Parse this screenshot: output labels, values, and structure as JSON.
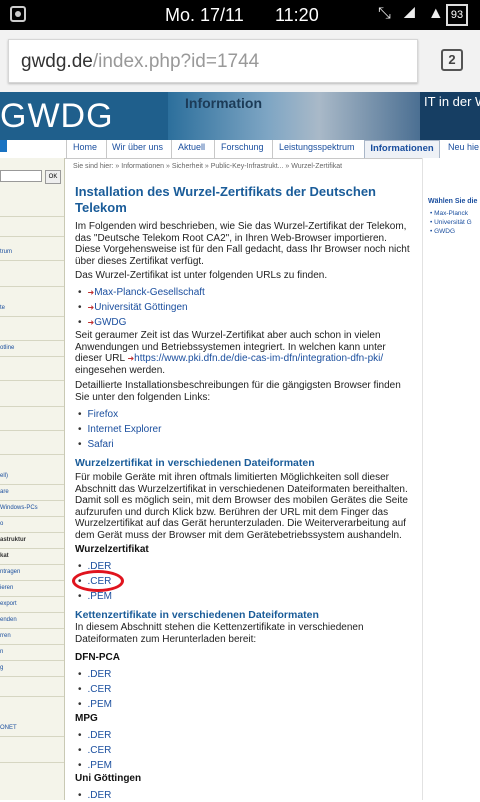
{
  "status": {
    "date": "Mo. 17/11",
    "time": "11:20",
    "battery": "93"
  },
  "browser": {
    "url_host": "gwdg.de",
    "url_path": "/index.php?id=1744",
    "tab_count": "2"
  },
  "banner": {
    "logo": "GWDG",
    "info_label": "Information",
    "tagline": "IT in der W"
  },
  "nav": {
    "items": [
      "Home",
      "Wir über uns",
      "Aktuell",
      "Forschung",
      "Leistungsspektrum"
    ],
    "active": "Informationen",
    "more": "Neu hie"
  },
  "sidebar": {
    "ok": "OK",
    "items": [
      "trum",
      "te",
      "otline",
      "ell)",
      "are",
      "Windows-PCs",
      "o",
      "astruktur",
      "kat",
      "ntragen",
      "ieren",
      "export",
      "enden",
      "rren",
      "n",
      "g",
      "ONET"
    ]
  },
  "breadcrumb": "Sie sind hier: » Informationen » Sicherheit » Public-Key-Infrastrukt... » Wurzel-Zertifikat",
  "right": {
    "title": "Wählen Sie die",
    "links": [
      "Max-Planck",
      "Universität G",
      "GWDG"
    ]
  },
  "main": {
    "title": "Installation des Wurzel-Zertifikats der Deutschen Telekom",
    "intro": "Im Folgenden wird beschrieben, wie Sie das Wurzel-Zertifikat der Telekom, das \"Deutsche Telekom Root CA2\", in Ihren Web-Browser importieren. Diese Vorgehensweise ist für den Fall gedacht, dass Ihr Browser noch nicht über dieses Zertifikat verfügt.",
    "urls_intro": "Das Wurzel-Zertifikat ist unter folgenden URLs zu finden.",
    "url_links": [
      "Max-Planck-Gesellschaft",
      "Universität Göttingen",
      "GWDG"
    ],
    "time_text": "Seit geraumer Zeit ist das Wurzel-Zertifikat aber auch schon in vielen Anwendungen und Betriebssystemen integriert. In welchen kann unter dieser URL ",
    "time_link": "https://www.pki.dfn.de/die-cas-im-dfn/integration-dfn-pki/",
    "time_end": " eingesehen werden.",
    "browsers_intro": "Detaillierte Installationsbeschreibungen für die gängigsten Browser finden Sie unter den folgenden Links:",
    "browsers": [
      "Firefox",
      "Internet Explorer",
      "Safari"
    ],
    "formats_title": "Wurzelzertifikat in verschiedenen Dateiformaten",
    "formats_text": "Für mobile Geräte mit ihren oftmals limitierten Möglichkeiten soll dieser Abschnitt das Wurzelzertifikat in verschiedenen Dateiformaten bereithalten. Damit soll es möglich sein, mit dem Browser des mobilen Gerätes die Seite aufzurufen und durch Klick bzw. Berühren der URL mit dem Finger das Wurzelzertifikat auf das Gerät herunterzuladen. Die Weiterverarbeitung auf dem Gerät muss der Browser mit dem Gerätebetriebssystem aushandeln.",
    "root_label": "Wurzelzertifikat",
    "root_files": [
      ".DER",
      ".CER",
      ".PEM"
    ],
    "chain_title": "Kettenzertifikate in verschiedenen Dateiformaten",
    "chain_text": "In diesem Abschnitt stehen die Kettenzertifikate in verschiedenen Dateiformaten zum Herunterladen bereit:",
    "dfn_label": "DFN-PCA",
    "dfn_files": [
      ".DER",
      ".CER",
      ".PEM"
    ],
    "mpg_label": "MPG",
    "mpg_files": [
      ".DER",
      ".CER",
      ".PEM"
    ],
    "uni_label": "Uni Göttingen",
    "uni_files": [
      ".DER"
    ]
  },
  "colors": {
    "link": "#1a4e9e",
    "heading": "#1a5c99",
    "banner": "#1f5f8c",
    "highlight_circle": "#e0141e"
  }
}
